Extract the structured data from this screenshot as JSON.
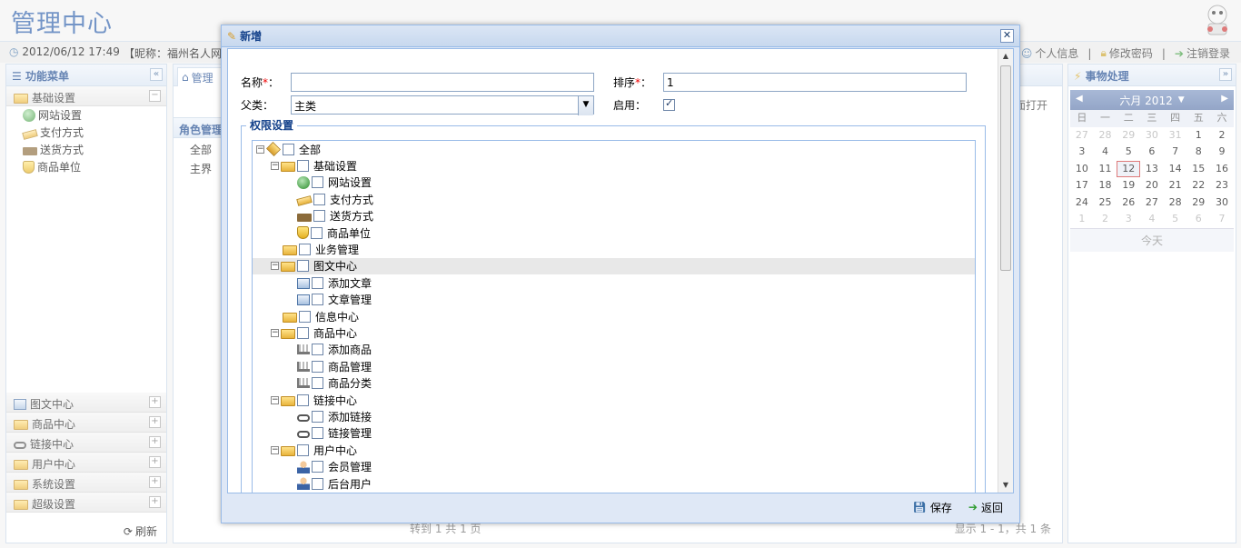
{
  "header": {
    "title": "管理中心"
  },
  "topbar": {
    "datetime": "2012/06/12 17:49",
    "nick": "【昵称：福州名人网络",
    "links": [
      {
        "label": "个人信息"
      },
      {
        "label": "修改密码"
      },
      {
        "label": "注销登录"
      }
    ]
  },
  "left": {
    "title": "功能菜单",
    "sections": [
      {
        "label": "基础设置",
        "expanded": true,
        "items": [
          {
            "label": "网站设置",
            "icon": "globe-icon"
          },
          {
            "label": "支付方式",
            "icon": "payment-icon"
          },
          {
            "label": "送货方式",
            "icon": "truck-icon"
          },
          {
            "label": "商品单位",
            "icon": "shield-icon"
          }
        ]
      },
      {
        "label": "图文中心"
      },
      {
        "label": "商品中心"
      },
      {
        "label": "链接中心"
      },
      {
        "label": "用户中心"
      },
      {
        "label": "系统设置"
      },
      {
        "label": "超级设置"
      }
    ],
    "refresh": "刷新"
  },
  "center": {
    "tab": "管理",
    "role_panel_title": "角色管理",
    "tree_items": [
      "全部",
      "主界"
    ],
    "open_btn": "面打开",
    "pager_left": "转到 1    共 1 页",
    "pager_right": "显示 1 - 1，共 1 条"
  },
  "right": {
    "title": "事物处理",
    "cal_month": "六月 2012",
    "weekdays": [
      "日",
      "一",
      "二",
      "三",
      "四",
      "五",
      "六"
    ],
    "weeks": [
      [
        "27",
        "28",
        "29",
        "30",
        "31",
        "1",
        "2"
      ],
      [
        "3",
        "4",
        "5",
        "6",
        "7",
        "8",
        "9"
      ],
      [
        "10",
        "11",
        "12",
        "13",
        "14",
        "15",
        "16"
      ],
      [
        "17",
        "18",
        "19",
        "20",
        "21",
        "22",
        "23"
      ],
      [
        "24",
        "25",
        "26",
        "27",
        "28",
        "29",
        "30"
      ],
      [
        "1",
        "2",
        "3",
        "4",
        "5",
        "6",
        "7"
      ]
    ],
    "today_day": "12",
    "today_btn": "今天"
  },
  "dialog": {
    "title": "新增",
    "name_label": "名称",
    "name_value": "",
    "order_label": "排序",
    "order_value": "1",
    "parent_label": "父类：",
    "parent_value": "主类",
    "enable_label": "启用：",
    "enable_checked": true,
    "perm_legend": "权限设置",
    "tree": [
      {
        "label": "全部",
        "level": 0,
        "icon": "box-icon",
        "exp": "−"
      },
      {
        "label": "基础设置",
        "level": 1,
        "icon": "folder-icon",
        "exp": "−"
      },
      {
        "label": "网站设置",
        "level": 2,
        "icon": "globe-icon"
      },
      {
        "label": "支付方式",
        "level": 2,
        "icon": "payment-icon"
      },
      {
        "label": "送货方式",
        "level": 2,
        "icon": "truck-icon"
      },
      {
        "label": "商品单位",
        "level": 2,
        "icon": "shield-icon"
      },
      {
        "label": "业务管理",
        "level": 1,
        "icon": "folder-icon"
      },
      {
        "label": "图文中心",
        "level": 1,
        "icon": "folder-icon",
        "exp": "−",
        "selected": true
      },
      {
        "label": "添加文章",
        "level": 2,
        "icon": "doc-icon"
      },
      {
        "label": "文章管理",
        "level": 2,
        "icon": "doc-icon"
      },
      {
        "label": "信息中心",
        "level": 1,
        "icon": "folder-icon"
      },
      {
        "label": "商品中心",
        "level": 1,
        "icon": "folder-icon",
        "exp": "−"
      },
      {
        "label": "添加商品",
        "level": 2,
        "icon": "cart-icon"
      },
      {
        "label": "商品管理",
        "level": 2,
        "icon": "cart-icon"
      },
      {
        "label": "商品分类",
        "level": 2,
        "icon": "cart-icon"
      },
      {
        "label": "链接中心",
        "level": 1,
        "icon": "folder-icon",
        "exp": "−"
      },
      {
        "label": "添加链接",
        "level": 2,
        "icon": "link-icon"
      },
      {
        "label": "链接管理",
        "level": 2,
        "icon": "link-icon"
      },
      {
        "label": "用户中心",
        "level": 1,
        "icon": "folder-icon",
        "exp": "−"
      },
      {
        "label": "会员管理",
        "level": 2,
        "icon": "user-icon"
      },
      {
        "label": "后台用户",
        "level": 2,
        "icon": "user-icon"
      }
    ],
    "save": "保存",
    "back": "返回"
  }
}
